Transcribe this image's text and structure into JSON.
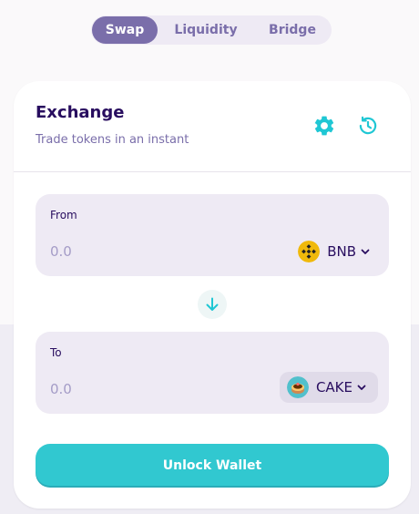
{
  "tabs": [
    {
      "label": "Swap",
      "active": true
    },
    {
      "label": "Liquidity",
      "active": false
    },
    {
      "label": "Bridge",
      "active": false
    }
  ],
  "card": {
    "title": "Exchange",
    "subtitle": "Trade tokens in an instant",
    "settings_icon": "gear-icon",
    "history_icon": "history-icon"
  },
  "from": {
    "label": "From",
    "amount": "0.0",
    "token": "BNB",
    "token_icon": "bnb-coin-icon"
  },
  "to": {
    "label": "To",
    "amount": "0.0",
    "token": "CAKE",
    "token_icon": "cake-coin-icon"
  },
  "unlock_label": "Unlock Wallet",
  "colors": {
    "primary": "#31c8d0",
    "accent": "#7a6eaa",
    "text": "#280d5f",
    "panel": "#eeeaf4"
  }
}
